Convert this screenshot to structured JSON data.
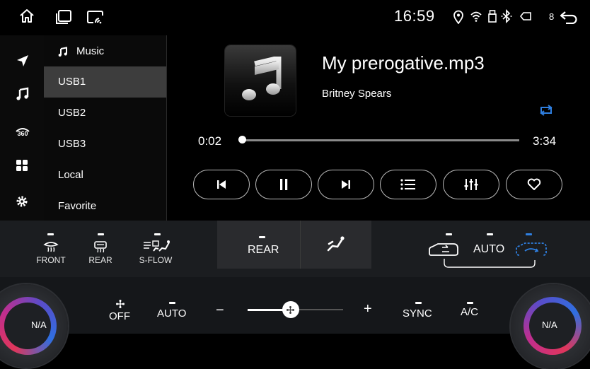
{
  "status_bar": {
    "time": "16:59",
    "battery_level": "8",
    "icons": [
      "home-icon",
      "recent-apps-icon",
      "screen-mirror-icon",
      "location-icon",
      "wifi-icon",
      "usb-icon",
      "bluetooth-icon",
      "battery-icon",
      "back-icon"
    ]
  },
  "rail": {
    "icons": [
      "navigation-icon",
      "music-icon",
      "camera-360-icon",
      "apps-icon",
      "settings-icon"
    ]
  },
  "source_list": {
    "header": "Music",
    "items": [
      {
        "label": "USB1",
        "active": true
      },
      {
        "label": "USB2",
        "active": false
      },
      {
        "label": "USB3",
        "active": false
      },
      {
        "label": "Local",
        "active": false
      },
      {
        "label": "Favorite",
        "active": false
      }
    ]
  },
  "player": {
    "title": "My prerogative.mp3",
    "artist": "Britney Spears",
    "elapsed": "0:02",
    "total": "3:34",
    "progress_fraction": 0.01,
    "repeat_mode": "repeat-all",
    "accent_color": "#2f7fe0",
    "controls": [
      "previous-button",
      "pause-button",
      "next-button",
      "playlist-button",
      "equalizer-button",
      "favorite-button"
    ]
  },
  "climate": {
    "front_label": "FRONT",
    "rear_label": "REAR",
    "sflow_label": "S-FLOW",
    "rear_center_label": "REAR",
    "auto_label": "AUTO",
    "off_label": "OFF",
    "fan_auto_label": "AUTO",
    "minus": "−",
    "plus": "+",
    "sync_label": "SYNC",
    "ac_label": "A/C",
    "left_temp": "N/A",
    "right_temp": "N/A",
    "fan_level_fraction": 0.45
  }
}
